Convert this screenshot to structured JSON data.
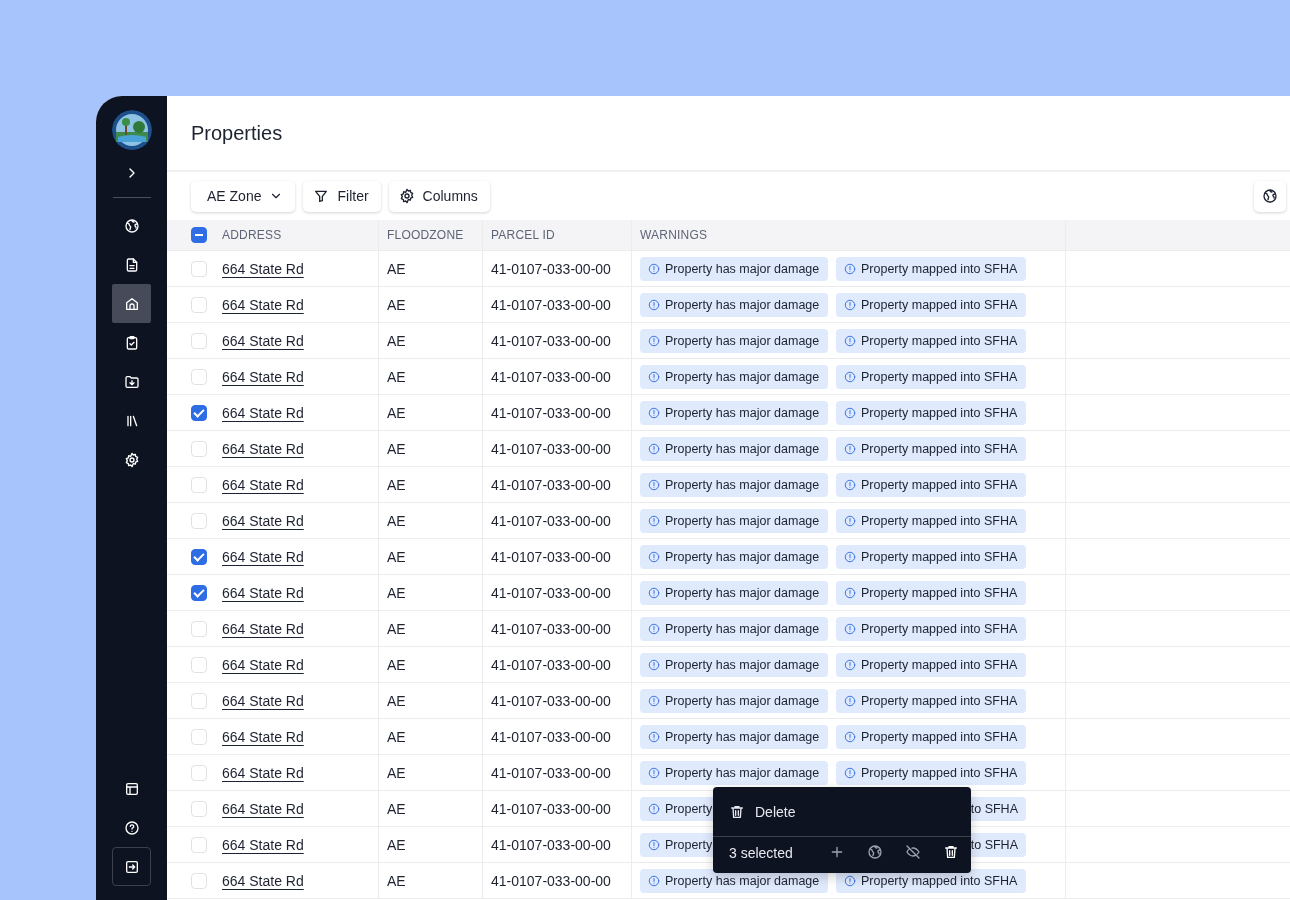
{
  "sidebar": {
    "top": [
      {
        "kind": "globe",
        "selected": false
      },
      {
        "kind": "document",
        "selected": false
      },
      {
        "kind": "home",
        "selected": true
      },
      {
        "kind": "clipboard",
        "selected": false
      },
      {
        "kind": "folder",
        "selected": false
      },
      {
        "kind": "library",
        "selected": false
      },
      {
        "kind": "settings",
        "selected": false
      }
    ],
    "bottom": [
      {
        "kind": "layout",
        "selected": false
      },
      {
        "kind": "help",
        "selected": false
      },
      {
        "kind": "exit",
        "selected": false
      }
    ]
  },
  "page": {
    "title": "Properties"
  },
  "toolbar": {
    "buttons": [
      {
        "kind": "dropdown",
        "label": "AE Zone"
      },
      {
        "kind": "filter",
        "label": "Filter"
      },
      {
        "kind": "columns",
        "label": "Columns"
      }
    ]
  },
  "table": {
    "select_all": {
      "checked": true,
      "indeterminate": true
    },
    "columns": [
      "ADDRESS",
      "FLOODZONE",
      "PARCEL ID",
      "WARNINGS"
    ],
    "rows": [
      {
        "selected": false,
        "address": "664 State Rd",
        "floodzone": "AE",
        "parcel_id": "41-0107-033-00-00",
        "warnings": [
          {
            "icon": true,
            "text": "Property has major damage"
          },
          {
            "icon": true,
            "text": "Property mapped into SFHA"
          }
        ]
      },
      {
        "selected": false,
        "address": "664 State Rd",
        "floodzone": "AE",
        "parcel_id": "41-0107-033-00-00",
        "warnings": [
          {
            "icon": true,
            "text": "Property has major damage"
          },
          {
            "icon": true,
            "text": "Property mapped into SFHA"
          }
        ]
      },
      {
        "selected": false,
        "address": "664 State Rd",
        "floodzone": "AE",
        "parcel_id": "41-0107-033-00-00",
        "warnings": [
          {
            "icon": true,
            "text": "Property has major damage"
          },
          {
            "icon": true,
            "text": "Property mapped into SFHA"
          }
        ]
      },
      {
        "selected": false,
        "address": "664 State Rd",
        "floodzone": "AE",
        "parcel_id": "41-0107-033-00-00",
        "warnings": [
          {
            "icon": true,
            "text": "Property has major damage"
          },
          {
            "icon": true,
            "text": "Property mapped into SFHA"
          }
        ]
      },
      {
        "selected": true,
        "address": "664 State Rd",
        "floodzone": "AE",
        "parcel_id": "41-0107-033-00-00",
        "warnings": [
          {
            "icon": true,
            "text": "Property has major damage"
          },
          {
            "icon": true,
            "text": "Property mapped into SFHA"
          }
        ]
      },
      {
        "selected": false,
        "address": "664 State Rd",
        "floodzone": "AE",
        "parcel_id": "41-0107-033-00-00",
        "warnings": [
          {
            "icon": true,
            "text": "Property has major damage"
          },
          {
            "icon": true,
            "text": "Property mapped into SFHA"
          }
        ]
      },
      {
        "selected": false,
        "address": "664 State Rd",
        "floodzone": "AE",
        "parcel_id": "41-0107-033-00-00",
        "warnings": [
          {
            "icon": true,
            "text": "Property has major damage"
          },
          {
            "icon": true,
            "text": "Property mapped into SFHA"
          }
        ]
      },
      {
        "selected": false,
        "address": "664 State Rd",
        "floodzone": "AE",
        "parcel_id": "41-0107-033-00-00",
        "warnings": [
          {
            "icon": true,
            "text": "Property has major damage"
          },
          {
            "icon": true,
            "text": "Property mapped into SFHA"
          }
        ]
      },
      {
        "selected": true,
        "address": "664 State Rd",
        "floodzone": "AE",
        "parcel_id": "41-0107-033-00-00",
        "warnings": [
          {
            "icon": true,
            "text": "Property has major damage"
          },
          {
            "icon": true,
            "text": "Property mapped into SFHA"
          }
        ]
      },
      {
        "selected": true,
        "address": "664 State Rd",
        "floodzone": "AE",
        "parcel_id": "41-0107-033-00-00",
        "warnings": [
          {
            "icon": true,
            "text": "Property has major damage"
          },
          {
            "icon": true,
            "text": "Property mapped into SFHA"
          }
        ]
      },
      {
        "selected": false,
        "address": "664 State Rd",
        "floodzone": "AE",
        "parcel_id": "41-0107-033-00-00",
        "warnings": [
          {
            "icon": true,
            "text": "Property has major damage"
          },
          {
            "icon": true,
            "text": "Property mapped into SFHA"
          }
        ]
      },
      {
        "selected": false,
        "address": "664 State Rd",
        "floodzone": "AE",
        "parcel_id": "41-0107-033-00-00",
        "warnings": [
          {
            "icon": true,
            "text": "Property has major damage"
          },
          {
            "icon": true,
            "text": "Property mapped into SFHA"
          }
        ]
      },
      {
        "selected": false,
        "address": "664 State Rd",
        "floodzone": "AE",
        "parcel_id": "41-0107-033-00-00",
        "warnings": [
          {
            "icon": true,
            "text": "Property has major damage"
          },
          {
            "icon": true,
            "text": "Property mapped into SFHA"
          }
        ]
      },
      {
        "selected": false,
        "address": "664 State Rd",
        "floodzone": "AE",
        "parcel_id": "41-0107-033-00-00",
        "warnings": [
          {
            "icon": true,
            "text": "Property has major damage"
          },
          {
            "icon": true,
            "text": "Property mapped into SFHA"
          }
        ]
      },
      {
        "selected": false,
        "address": "664 State Rd",
        "floodzone": "AE",
        "parcel_id": "41-0107-033-00-00",
        "warnings": [
          {
            "icon": true,
            "text": "Property has major damage"
          },
          {
            "icon": true,
            "text": "Property mapped into SFHA"
          }
        ]
      },
      {
        "selected": false,
        "address": "664 State Rd",
        "floodzone": "AE",
        "parcel_id": "41-0107-033-00-00",
        "warnings": [
          {
            "icon": true,
            "text": "Property"
          },
          {
            "icon": false,
            "text": "to SFHA"
          }
        ]
      },
      {
        "selected": false,
        "address": "664 State Rd",
        "floodzone": "AE",
        "parcel_id": "41-0107-033-00-00",
        "warnings": [
          {
            "icon": true,
            "text": "Property"
          },
          {
            "icon": false,
            "text": "to SFHA"
          }
        ]
      },
      {
        "selected": false,
        "address": "664 State Rd",
        "floodzone": "AE",
        "parcel_id": "41-0107-033-00-00",
        "warnings": [
          {
            "icon": true,
            "text": "Property has major damage"
          },
          {
            "icon": true,
            "text": "Property mapped into SFHA"
          }
        ]
      }
    ]
  },
  "selection_bar": {
    "action": "Delete",
    "count": "3 selected"
  }
}
